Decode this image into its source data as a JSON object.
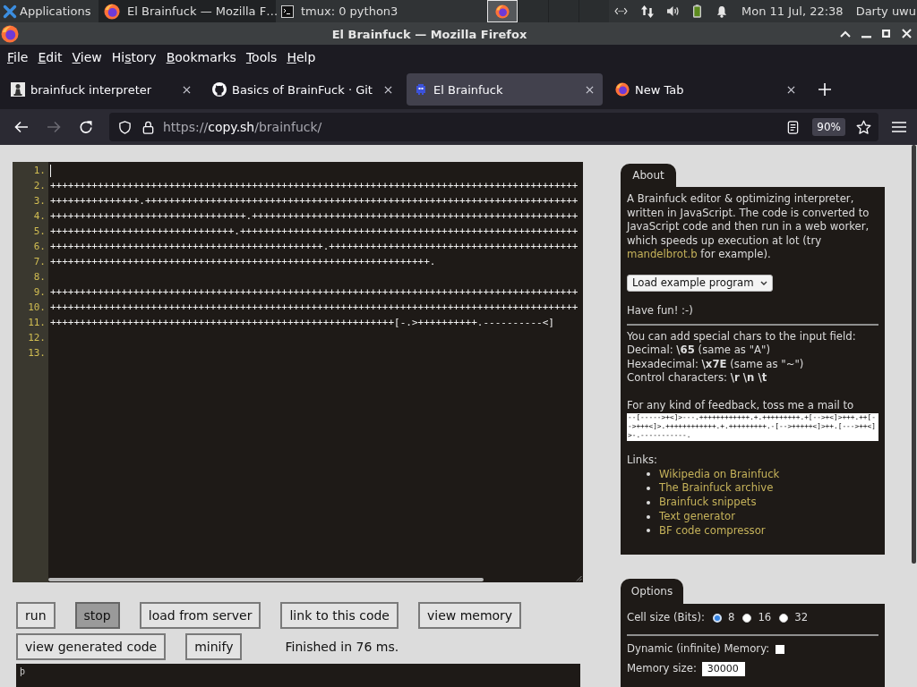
{
  "taskbar": {
    "menu_label": "Applications",
    "windows": [
      {
        "title": "El Brainfuck — Mozilla F…",
        "kind": "browser",
        "selected": true
      },
      {
        "title": "tmux: 0 python3",
        "kind": "terminal",
        "selected": false
      }
    ],
    "workspaces": [
      {
        "selected": true,
        "occupied": true
      },
      {
        "selected": false,
        "occupied": false
      },
      {
        "selected": false,
        "occupied": false
      },
      {
        "selected": false,
        "occupied": false
      }
    ],
    "clock": "Mon 11 Jul, 22:38",
    "user": "Darty uwu"
  },
  "window": {
    "title": "El Brainfuck — Mozilla Firefox"
  },
  "menu": [
    {
      "key": "F",
      "rest": "ile"
    },
    {
      "key": "E",
      "rest": "dit"
    },
    {
      "key": "V",
      "rest": "iew"
    },
    {
      "pre": "Hi",
      "key": "s",
      "rest": "tory"
    },
    {
      "key": "B",
      "rest": "ookmarks"
    },
    {
      "key": "T",
      "rest": "ools"
    },
    {
      "key": "H",
      "rest": "elp"
    }
  ],
  "tabs": [
    {
      "title": "brainfuck interpreter",
      "kind": "pawn",
      "selected": false
    },
    {
      "title": "Basics of BrainFuck · Git",
      "kind": "cat",
      "selected": false
    },
    {
      "title": "El Brainfuck",
      "kind": "invader",
      "selected": true
    },
    {
      "title": "New Tab",
      "kind": "browser",
      "selected": false
    }
  ],
  "navigation": {
    "back": {
      "disabled": false
    },
    "forward": {
      "disabled": true
    },
    "url": {
      "scheme": "https://",
      "host": "copy.sh",
      "path": "/brainfuck/"
    },
    "zoom": "90%"
  },
  "editor": {
    "lines": [
      {
        "number": "1.",
        "cursor": true
      },
      {
        "number": "2.",
        "cursor": false,
        "text": "+++++++++++++++++++++++++++++++++++++++++++++++++++++++++++++++++++++++++++++++++++++++++"
      },
      {
        "number": "3.",
        "cursor": false,
        "text": "+++++++++++++++.+++++++++++++++++++++++++++++++++++++++++++++++++++++++++++++++++++++++++"
      },
      {
        "number": "4.",
        "cursor": false,
        "text": "+++++++++++++++++++++++++++++++++.+++++++++++++++++++++++++++++++++++++++++++++++++++++++"
      },
      {
        "number": "5.",
        "cursor": false,
        "text": "+++++++++++++++++++++++++++++++.+++++++++++++++++++++++++++++++++++++++++++++++++++++++++"
      },
      {
        "number": "6.",
        "cursor": false,
        "text": "++++++++++++++++++++++++++++++++++++++++++++++.++++++++++++++++++++++++++++++++++++++++++"
      },
      {
        "number": "7.",
        "cursor": false,
        "text": "++++++++++++++++++++++++++++++++++++++++++++++++++++++++++++++++."
      },
      {
        "number": "8.",
        "cursor": false
      },
      {
        "number": "9.",
        "cursor": false,
        "text": "+++++++++++++++++++++++++++++++++++++++++++++++++++++++++++++++++++++++++++++++++++++++++"
      },
      {
        "number": "10.",
        "cursor": false,
        "text": "+++++++++++++++++++++++++++++++++++++++++++++++++++++++++++++++++++++++++++++++++++++++++"
      },
      {
        "number": "11.",
        "cursor": false,
        "text": "++++++++++++++++++++++++++++++++++++++++++++++++++++++++++[-.>++++++++++.----------<]"
      },
      {
        "number": "12.",
        "cursor": false
      },
      {
        "number": "13.",
        "cursor": false
      }
    ]
  },
  "actions": {
    "buttons": [
      {
        "label": "run",
        "pressed": false
      },
      {
        "label": "stop",
        "pressed": true
      },
      {
        "label": "load from server",
        "pressed": false
      },
      {
        "label": "link to this code",
        "pressed": false
      },
      {
        "label": "view memory",
        "pressed": false
      },
      {
        "label": "view generated code",
        "pressed": false
      },
      {
        "label": "minify",
        "pressed": false
      }
    ],
    "status": "Finished in 76 ms."
  },
  "output": {
    "lines": [
      "þ"
    ]
  },
  "about": {
    "tab": "About",
    "description": {
      "before": "A Brainfuck editor & optimizing interpreter, written in JavaScript. The code is converted to JavaScript code and then run in a web worker, which speeds up execution at lot (try ",
      "link": "mandelbrot.b",
      "after": " for example)."
    },
    "select": "Load example program",
    "greeting": "Have fun! :-)",
    "special_chars": [
      "You can add special chars to the input field:",
      "Decimal: **\\65** (same as \"A\")",
      "Hexadecimal: **\\x7E** (same as \"~\")",
      "Control characters: **\\r \\n \\t**"
    ],
    "feedback": "For any kind of feedback, toss me a mail to",
    "mail_code": "--[----->+<]>---.++++++++++++.+.+++++++++.+[-->+<]>+++.++[-->+++<]>.++++++++++++.+.+++++++++.-[-->+++++<]>++.[--->++<]>-.-----------.",
    "links_heading": "Links:",
    "links": [
      "Wikipedia on Brainfuck",
      "The Brainfuck archive",
      "Brainfuck snippets",
      "Text generator",
      "BF code compressor"
    ]
  },
  "options": {
    "tab": "Options",
    "cell_size": {
      "label": "Cell size (Bits):",
      "choices": [
        {
          "label": "8",
          "selected": true
        },
        {
          "label": "16",
          "selected": false
        },
        {
          "label": "32",
          "selected": false
        }
      ]
    },
    "dynamic_memory": {
      "label": "Dynamic (infinite) Memory:",
      "checked": false
    },
    "memory_size": {
      "label": "Memory size:",
      "value": "30000"
    }
  }
}
